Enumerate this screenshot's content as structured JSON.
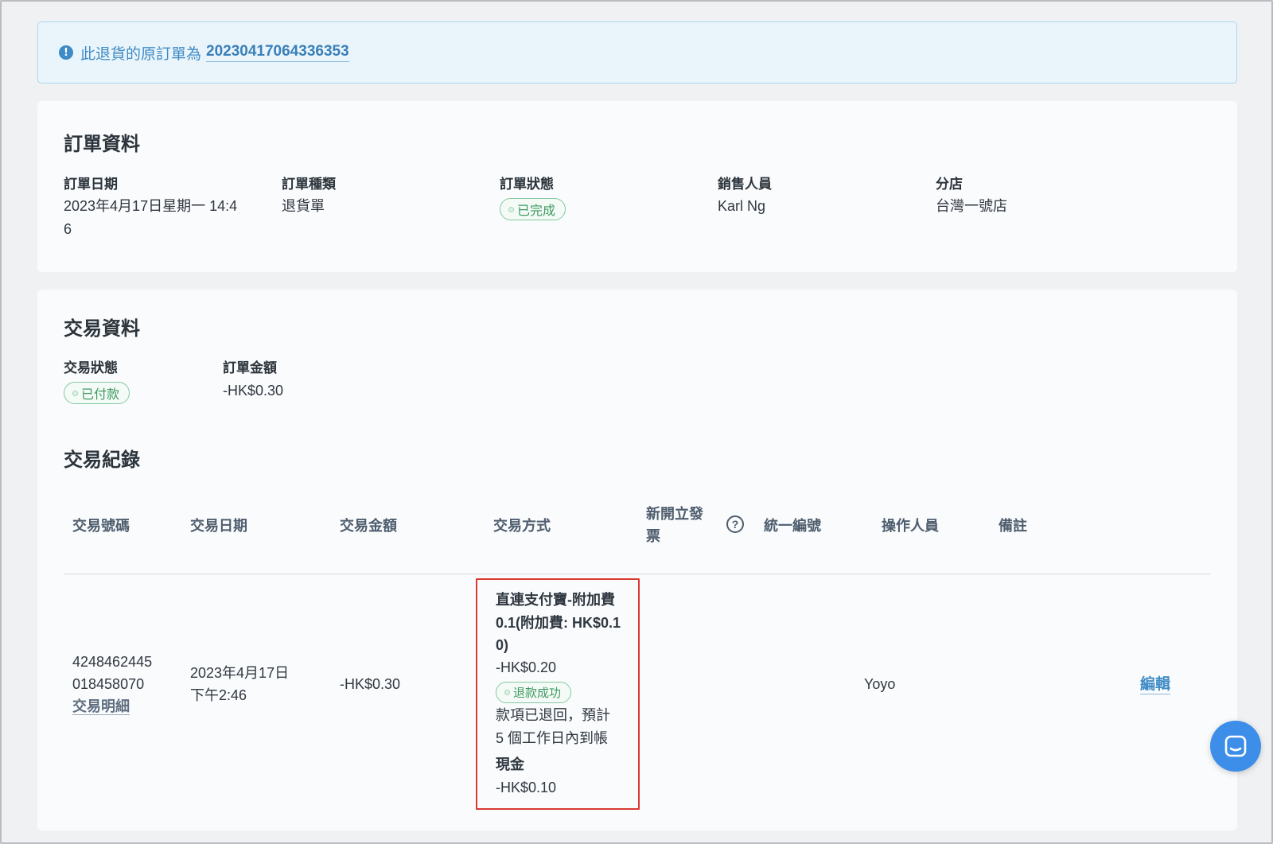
{
  "notice": {
    "text": "此退貨的原訂單為",
    "order_number": "20230417064336353"
  },
  "order_info": {
    "title": "訂單資料",
    "fields": [
      {
        "label": "訂單日期",
        "value_line1": "2023年4月17日星期一 14:4",
        "value_line2": "6"
      },
      {
        "label": "訂單種類",
        "value": "退貨單"
      },
      {
        "label": "訂單狀態",
        "badge": "已完成"
      },
      {
        "label": "銷售人員",
        "value": "Karl Ng"
      },
      {
        "label": "分店",
        "value": "台灣一號店"
      }
    ]
  },
  "transaction_info": {
    "title": "交易資料",
    "status_label": "交易狀態",
    "status_badge": "已付款",
    "amount_label": "訂單金額",
    "amount_value": "-HK$0.30"
  },
  "transaction_records": {
    "title": "交易紀錄",
    "columns": {
      "tx_number": "交易號碼",
      "tx_date": "交易日期",
      "tx_amount": "交易金額",
      "tx_method": "交易方式",
      "new_invoice_line1": "新開立發",
      "new_invoice_line2": "票",
      "tax_id": "統一編號",
      "operator": "操作人員",
      "remarks": "備註"
    },
    "rows": [
      {
        "tx_number_line1": "4248462445",
        "tx_number_line2": "018458070",
        "detail_link": "交易明細",
        "date_line1": "2023年4月17日",
        "date_line2": "下午2:46",
        "amount": "-HK$0.30",
        "methods": {
          "name_line1": "直連支付寶-附加費",
          "name_line2": "0.1(附加費: HK$0.1",
          "name_line3": "0)",
          "amount1": "-HK$0.20",
          "refund_badge": "退款成功",
          "refund_note_line1": "款項已退回，預計",
          "refund_note_line2": "5 個工作日內到帳",
          "cash_label": "現金",
          "amount2": "-HK$0.10"
        },
        "operator": "Yoyo",
        "edit_link": "編輯"
      }
    ]
  },
  "icons": {
    "info": "info-circle-icon",
    "help": "question-circle-icon",
    "chat": "chat-bubble-icon"
  },
  "colors": {
    "accent": "#3f8bc6",
    "success": "#3f9a63",
    "highlight_border": "#d93a30",
    "chat_button": "#3d8ee9"
  }
}
